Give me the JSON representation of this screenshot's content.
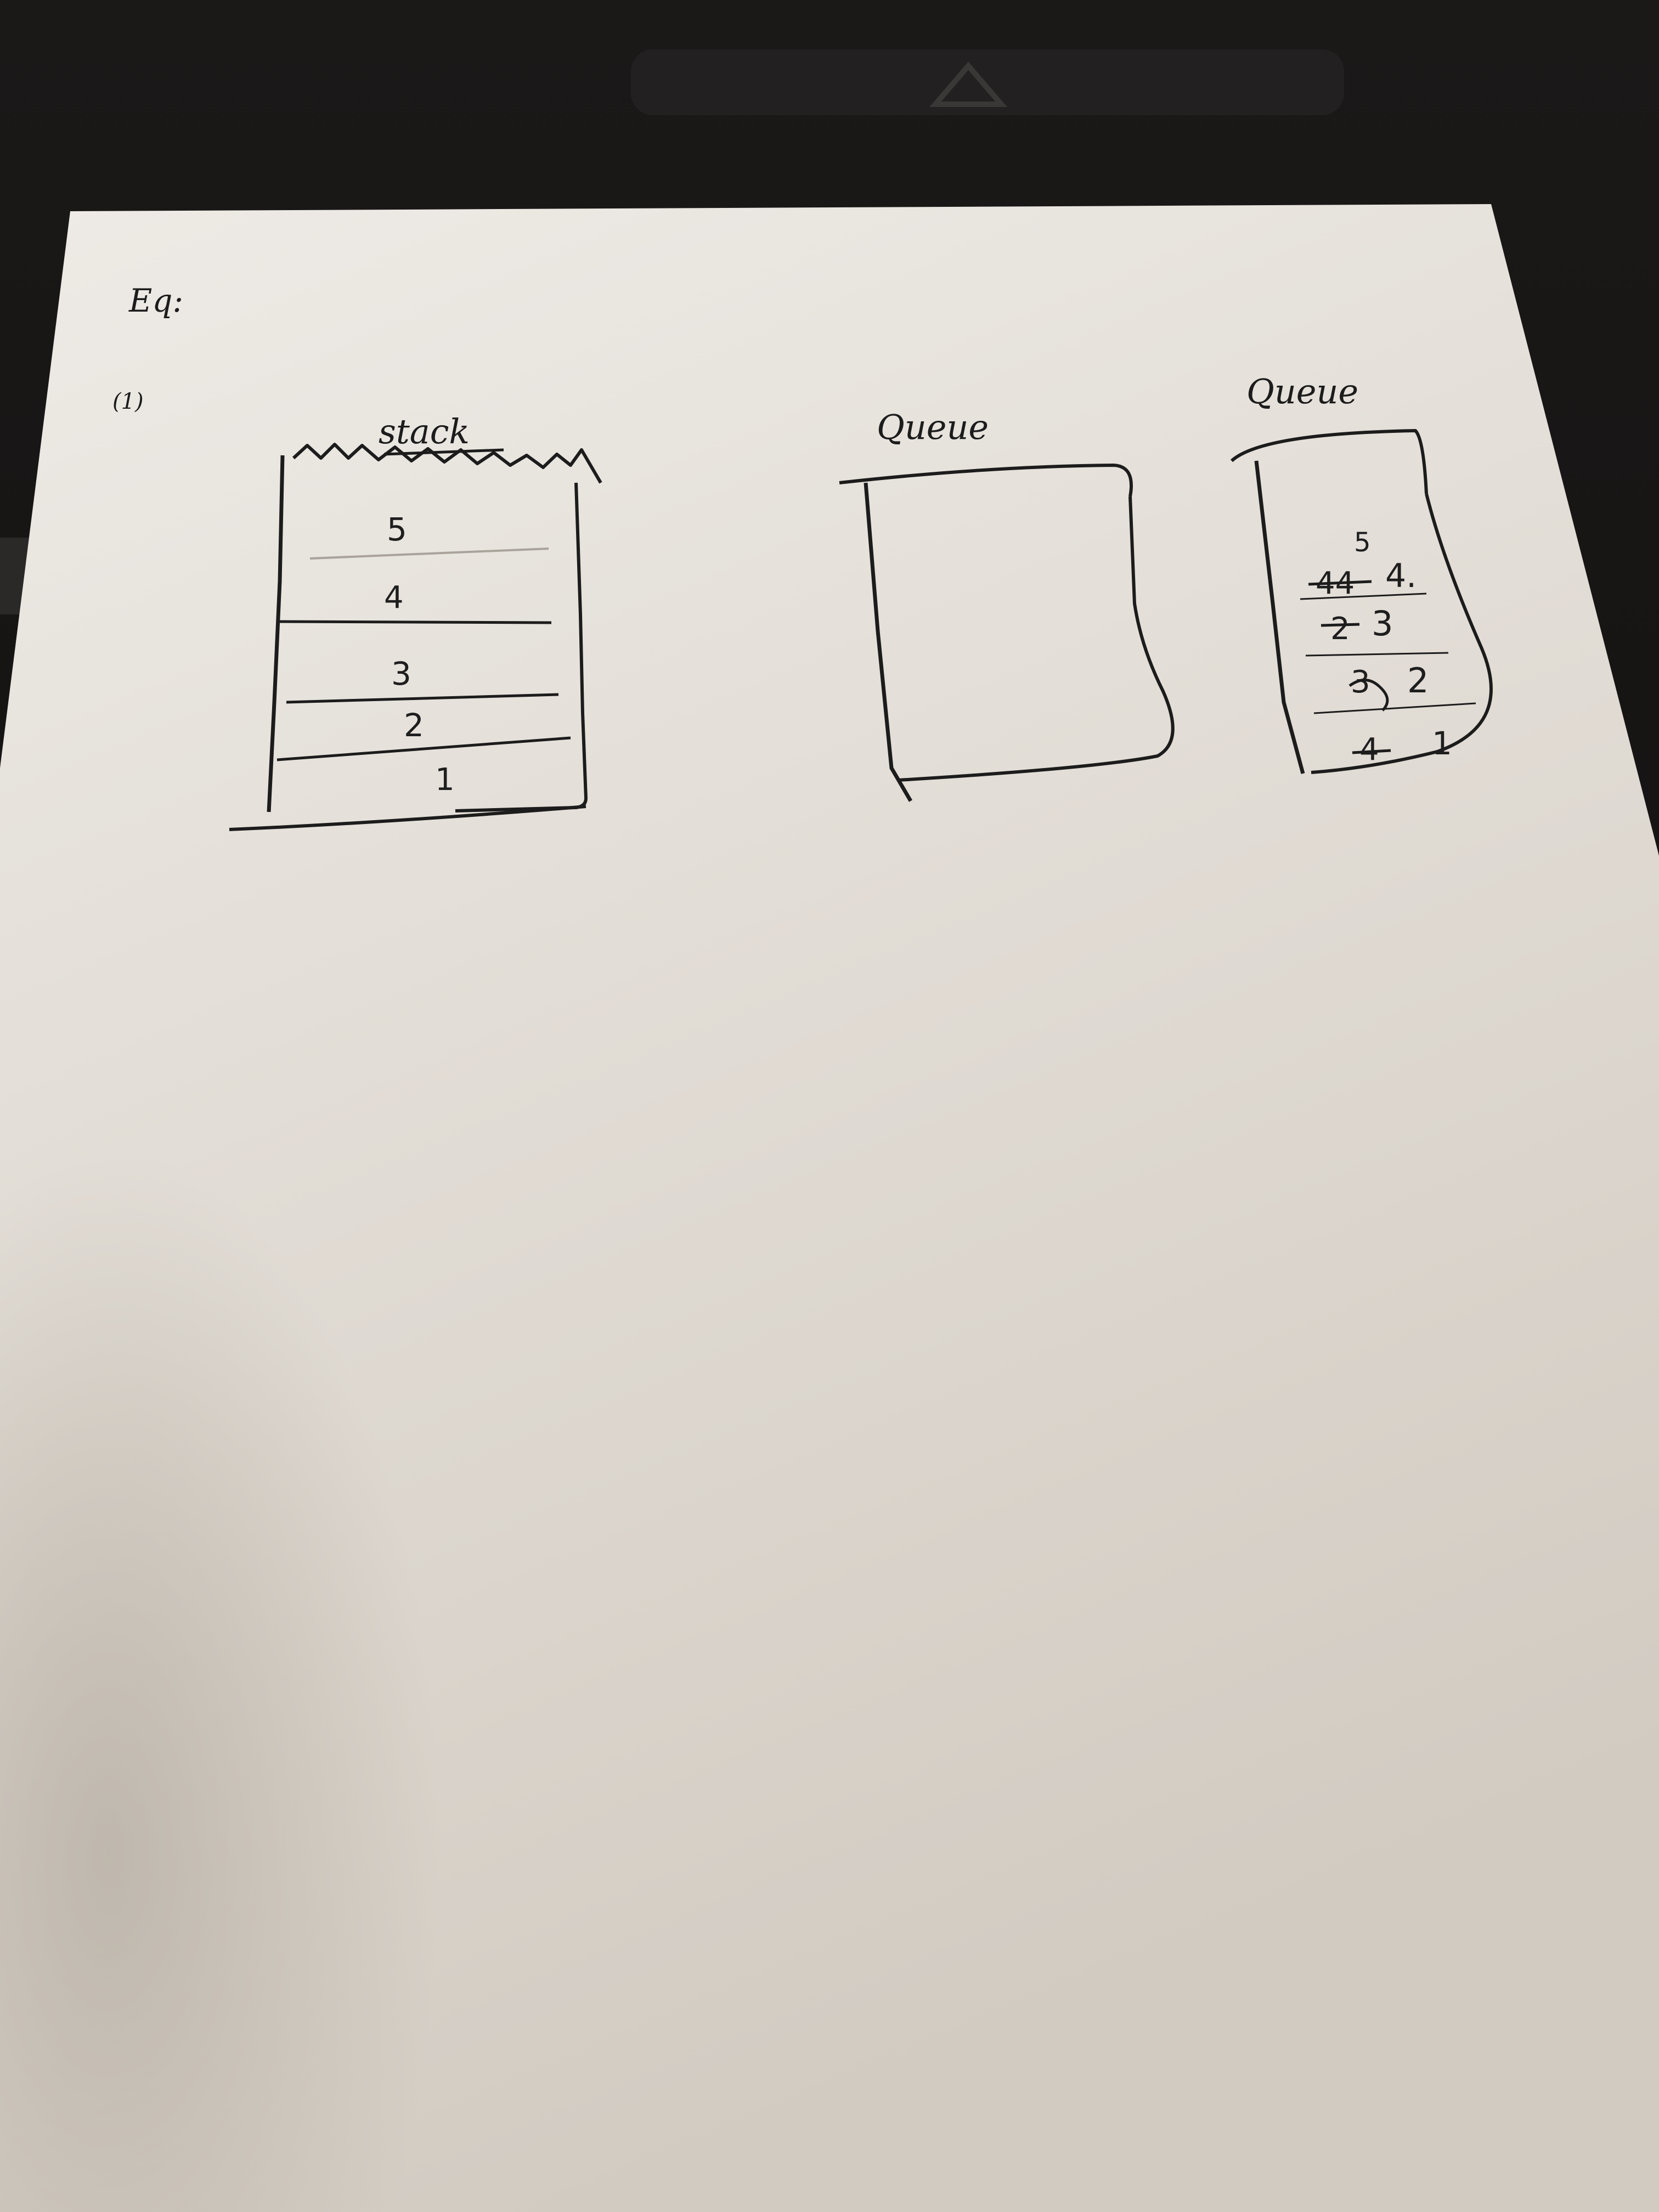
{
  "colors": {
    "background": "#141211",
    "paper_light": "#ece9e4",
    "paper_mid": "#d9d3cb",
    "paper_shadow": "#b9b2a8",
    "ink": "#1c1c1c"
  },
  "header": {
    "label": "Eq:",
    "sub_label": "(1)"
  },
  "stack": {
    "title": "stack",
    "items": [
      "5",
      "4",
      "3",
      "2",
      "1"
    ]
  },
  "queue_empty": {
    "title": "Queue"
  },
  "queue_filled": {
    "title": "Queue",
    "top_item": "5",
    "rows": [
      {
        "crossed": "44",
        "value": "4."
      },
      {
        "crossed": "2",
        "value": "3"
      },
      {
        "crossed": "3",
        "value": "2"
      },
      {
        "crossed": "4",
        "value": "1"
      }
    ]
  }
}
